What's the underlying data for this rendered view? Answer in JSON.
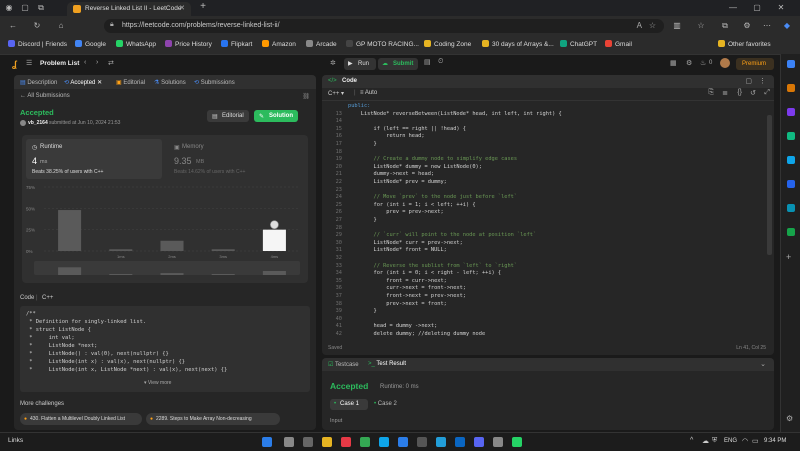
{
  "browser": {
    "tab_title": "Reverse Linked List II - LeetCode",
    "url": "https://leetcode.com/problems/reverse-linked-list-ii/"
  },
  "bookmarks": [
    {
      "label": "Discord | Friends",
      "color": "#5865f2"
    },
    {
      "label": "Google",
      "color": "#4285f4"
    },
    {
      "label": "WhatsApp",
      "color": "#25d366"
    },
    {
      "label": "Price History",
      "color": "#8e44ad"
    },
    {
      "label": "Flipkart",
      "color": "#2874f0"
    },
    {
      "label": "Amazon",
      "color": "#ff9900"
    },
    {
      "label": "Arcade",
      "color": "#888888"
    },
    {
      "label": "GP MOTO RACING...",
      "color": "#444444"
    },
    {
      "label": "Coding Zone",
      "color": "#e6b422"
    },
    {
      "label": "30 days of Arrays &...",
      "color": "#e6b422"
    },
    {
      "label": "ChatGPT",
      "color": "#10a37f"
    },
    {
      "label": "Gmail",
      "color": "#ea4335"
    },
    {
      "label": "Other favorites",
      "color": "#e6b422"
    }
  ],
  "lc_header": {
    "problem_list": "Problem List",
    "run": "Run",
    "submit": "Submit",
    "premium": "Premium",
    "streak": "0"
  },
  "left_tabs": [
    "Description",
    "Accepted",
    "Editorial",
    "Solutions",
    "Submissions"
  ],
  "submission": {
    "back": "All Submissions",
    "status": "Accepted",
    "user": "vb_2164",
    "submitted_at": "submitted at Jun 10, 2024 21:53",
    "editorial_btn": "Editorial",
    "solution_btn": "Solution",
    "runtime_label": "Runtime",
    "runtime_value": "4",
    "runtime_unit": "ms",
    "runtime_beats": "Beats 38.25% of users with C++",
    "memory_label": "Memory",
    "memory_value": "9.35",
    "memory_unit": "MB",
    "memory_beats": "Beats 14.62% of users with C++"
  },
  "chart_data": {
    "type": "bar",
    "y_ticks": [
      "75%",
      "50%",
      "25%",
      "0%"
    ],
    "categories": [
      "",
      "1ms",
      "2ms",
      "3ms",
      "4ms"
    ],
    "values": [
      48,
      2,
      12,
      2,
      25
    ],
    "ylim": [
      0,
      75
    ],
    "highlight_index": 4,
    "grid": true
  },
  "code_section": {
    "label": "Code",
    "lang": "C++",
    "lines": [
      "/**",
      " * Definition for singly-linked list.",
      " * struct ListNode {",
      " *     int val;",
      " *     ListNode *next;",
      " *     ListNode() : val(0), next(nullptr) {}",
      " *     ListNode(int x) : val(x), next(nullptr) {}",
      " *     ListNode(int x, ListNode *next) : val(x), next(next) {}"
    ],
    "view_more": "View more"
  },
  "more_challenges": {
    "title": "More challenges",
    "items": [
      "430. Flatten a Multilevel Doubly Linked List",
      "2289. Steps to Make Array Non-decreasing"
    ]
  },
  "editor": {
    "title": "Code",
    "lang": "C++",
    "mode": "Auto",
    "saved": "Saved",
    "cursor": "Ln 41, Col 25",
    "lines": [
      {
        "n": "",
        "t": "public:"
      },
      {
        "n": "13",
        "t": "    ListNode* reverseBetween(ListNode* head, int left, int right) {"
      },
      {
        "n": "14",
        "t": ""
      },
      {
        "n": "15",
        "t": "        if (left == right || !head) {"
      },
      {
        "n": "16",
        "t": "            return head;"
      },
      {
        "n": "17",
        "t": "        }"
      },
      {
        "n": "18",
        "t": ""
      },
      {
        "n": "19",
        "t": "        // Create a dummy node to simplify edge cases"
      },
      {
        "n": "20",
        "t": "        ListNode* dummy = new ListNode(0);"
      },
      {
        "n": "21",
        "t": "        dummy->next = head;"
      },
      {
        "n": "22",
        "t": "        ListNode* prev = dummy;"
      },
      {
        "n": "23",
        "t": ""
      },
      {
        "n": "24",
        "t": "        // Move `prev` to the node just before `left`"
      },
      {
        "n": "25",
        "t": "        for (int i = 1; i < left; ++i) {"
      },
      {
        "n": "26",
        "t": "            prev = prev->next;"
      },
      {
        "n": "27",
        "t": "        }"
      },
      {
        "n": "28",
        "t": ""
      },
      {
        "n": "29",
        "t": "        // `curr` will point to the node at position `left`"
      },
      {
        "n": "30",
        "t": "        ListNode* curr = prev->next;"
      },
      {
        "n": "31",
        "t": "        ListNode* front = NULL;"
      },
      {
        "n": "32",
        "t": ""
      },
      {
        "n": "33",
        "t": "        // Reverse the sublist from `left` to `right`"
      },
      {
        "n": "34",
        "t": "        for (int i = 0; i < right - left; ++i) {"
      },
      {
        "n": "35",
        "t": "            front = curr->next;"
      },
      {
        "n": "36",
        "t": "            curr->next = front->next;"
      },
      {
        "n": "37",
        "t": "            front->next = prev->next;"
      },
      {
        "n": "38",
        "t": "            prev->next = front;"
      },
      {
        "n": "39",
        "t": "        }"
      },
      {
        "n": "40",
        "t": ""
      },
      {
        "n": "41",
        "t": "        head = dummy ->next;"
      },
      {
        "n": "42",
        "t": "        delete dummy; //deleting dummy node"
      }
    ]
  },
  "test": {
    "tab1": "Testcase",
    "tab2": "Test Result",
    "status": "Accepted",
    "runtime": "Runtime: 0 ms",
    "case1": "Case 1",
    "case2": "Case 2",
    "input": "Input"
  },
  "taskbar": {
    "links": "Links",
    "lang": "ENG",
    "time": "9:34 PM"
  }
}
